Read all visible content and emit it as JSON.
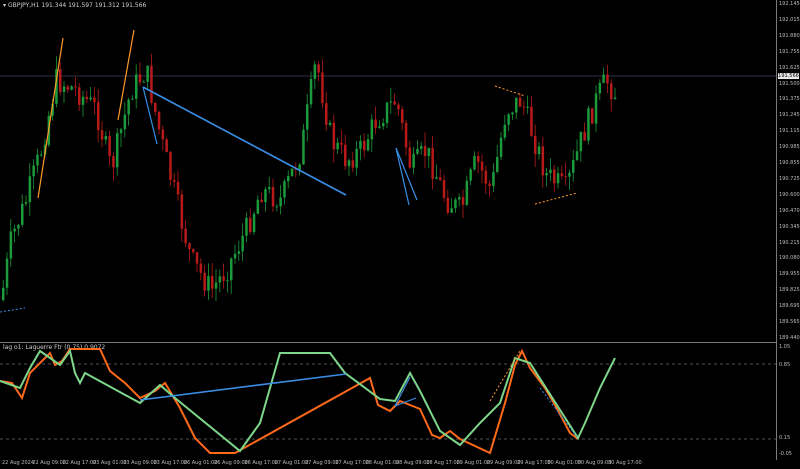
{
  "header": {
    "symbol_icon": "triangle-down-icon",
    "title": "GBPJPY,H1  191.344 191.597 191.312 191.566"
  },
  "indicator": {
    "label": "lag o1: Laguerre Ftr (0.75) 0.9072"
  },
  "price_axis": {
    "ticks": [
      "192.145",
      "192.015",
      "191.880",
      "191.755",
      "191.625",
      "191.500",
      "191.375",
      "191.245",
      "191.115",
      "190.985",
      "190.855",
      "190.725",
      "190.600",
      "190.470",
      "190.345",
      "190.215",
      "190.080",
      "189.955",
      "189.825",
      "189.695",
      "189.565",
      "189.440"
    ],
    "current_price": "191.566"
  },
  "indicator_axis": {
    "ticks": [
      "1.05",
      "0.85",
      "0.15",
      "-0.05"
    ]
  },
  "time_axis": {
    "ticks": [
      "22 Aug 2024",
      "22 Aug 09:00",
      "22 Aug 17:00",
      "23 Aug 01:00",
      "23 Aug 09:00",
      "23 Aug 17:00",
      "26 Aug 01:00",
      "26 Aug 09:00",
      "26 Aug 17:00",
      "27 Aug 01:00",
      "27 Aug 09:00",
      "27 Aug 17:00",
      "28 Aug 01:00",
      "28 Aug 09:00",
      "28 Aug 17:00",
      "29 Aug 01:00",
      "29 Aug 09:00",
      "29 Aug 17:00",
      "30 Aug 01:00",
      "30 Aug 09:00",
      "30 Aug 17:00"
    ]
  },
  "colors": {
    "background": "#000000",
    "bull": "#1a9a3a",
    "bear": "#b81a1a",
    "wick": "#c0c0c0",
    "line_up": "#7dd68a",
    "line_down": "#ff6a1a",
    "blue_trend": "#3a8ee6",
    "orange_trend": "#ff9a2a",
    "axis": "#7a7a7a"
  }
}
